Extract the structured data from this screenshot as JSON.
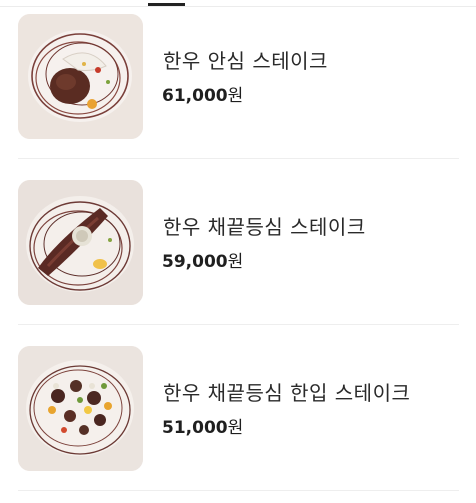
{
  "menu": {
    "items": [
      {
        "name": "한우 안심 스테이크",
        "price": "61,000",
        "unit": "원"
      },
      {
        "name": "한우 채끝등심 스테이크",
        "price": "59,000",
        "unit": "원"
      },
      {
        "name": "한우 채끝등심 한입 스테이크",
        "price": "51,000",
        "unit": "원"
      }
    ]
  },
  "colors": {
    "divider": "#eeeeee",
    "text": "#2a2a2a",
    "tab_indicator": "#222222"
  }
}
